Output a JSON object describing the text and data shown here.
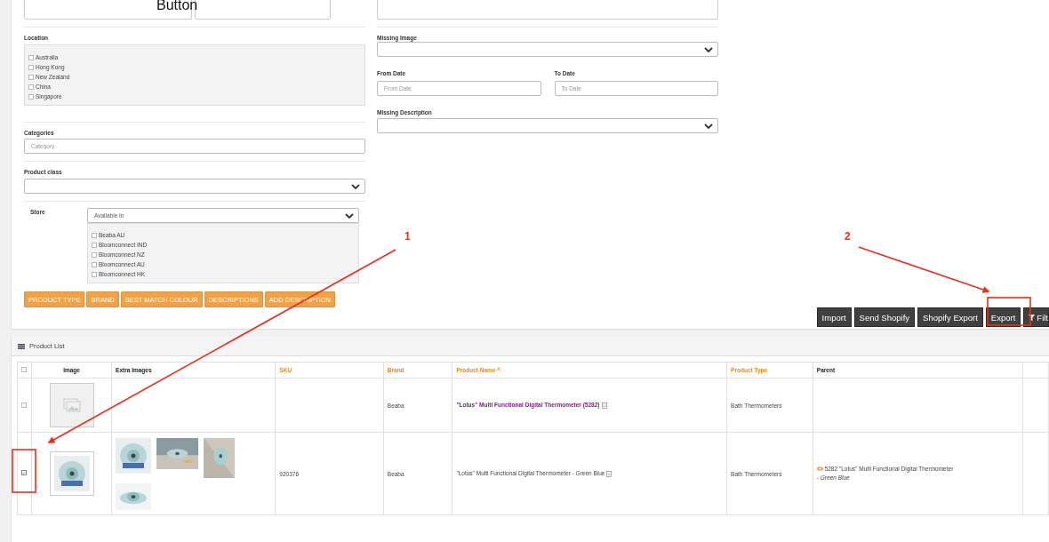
{
  "annotation": {
    "caption": "Button",
    "labels": [
      {
        "text": "1"
      },
      {
        "text": "2"
      }
    ]
  },
  "filters": {
    "location": {
      "label": "Location",
      "options": [
        {
          "label": "Australia",
          "checked": false
        },
        {
          "label": "Hong Kong",
          "checked": false
        },
        {
          "label": "New Zealand",
          "checked": false
        },
        {
          "label": "China",
          "checked": false
        },
        {
          "label": "Singapore",
          "checked": false
        }
      ]
    },
    "categories": {
      "label": "Categories",
      "placeholder": "Category"
    },
    "product_class": {
      "label": "Product class"
    },
    "store": {
      "label": "Store",
      "select_value": "Available In",
      "options": [
        {
          "label": "Beaba AU",
          "checked": false
        },
        {
          "label": "Bloomconnect IND",
          "checked": false
        },
        {
          "label": "Bloomconnect NZ",
          "checked": false
        },
        {
          "label": "Bloomconnect AU",
          "checked": false
        },
        {
          "label": "Bloomconnect HK",
          "checked": false
        }
      ]
    },
    "tag_buttons": [
      "PRODUCT TYPE",
      "BRAND",
      "BEST MATCH COLOUR",
      "DESCRIPTIONS",
      "ADD DESCRIPTION"
    ],
    "missing_image": {
      "label": "Missing Image"
    },
    "from_date": {
      "label": "From Date",
      "placeholder": "From Date"
    },
    "to_date": {
      "label": "To Date",
      "placeholder": "To Date"
    },
    "missing_description": {
      "label": "Missing Description"
    }
  },
  "actions": [
    "Import",
    "Send Shopify",
    "Shopify Export",
    "Export",
    "Filt"
  ],
  "product_list": {
    "title": "Product List",
    "header_checked": false,
    "columns": [
      {
        "label": "Image",
        "sortable": false
      },
      {
        "label": "Extra Images",
        "sortable": false
      },
      {
        "label": "SKU",
        "sortable": true
      },
      {
        "label": "Brand",
        "sortable": true
      },
      {
        "label": "Product Name",
        "sortable": true,
        "sort_indicator": "^"
      },
      {
        "label": "Product Type",
        "sortable": true
      },
      {
        "label": "Parent",
        "sortable": false
      }
    ],
    "rows": [
      {
        "kind": "parent",
        "checked": false,
        "brand": "Beaba",
        "name": "\"Lotus\" Multi Functional Digital Thermometer  (5282)",
        "product_type": "Bath Thermometers"
      },
      {
        "kind": "variant",
        "checked": true,
        "sku": "920376",
        "brand": "Beaba",
        "name": "\"Lotus\" Multi Functional Digital Thermometer - Green Blue",
        "product_type": "Bath Thermometers",
        "parent": "5282 \"Lotus\" Multi Functional Digital Thermometer",
        "parent_variant": "- *Green Blue*"
      }
    ]
  }
}
